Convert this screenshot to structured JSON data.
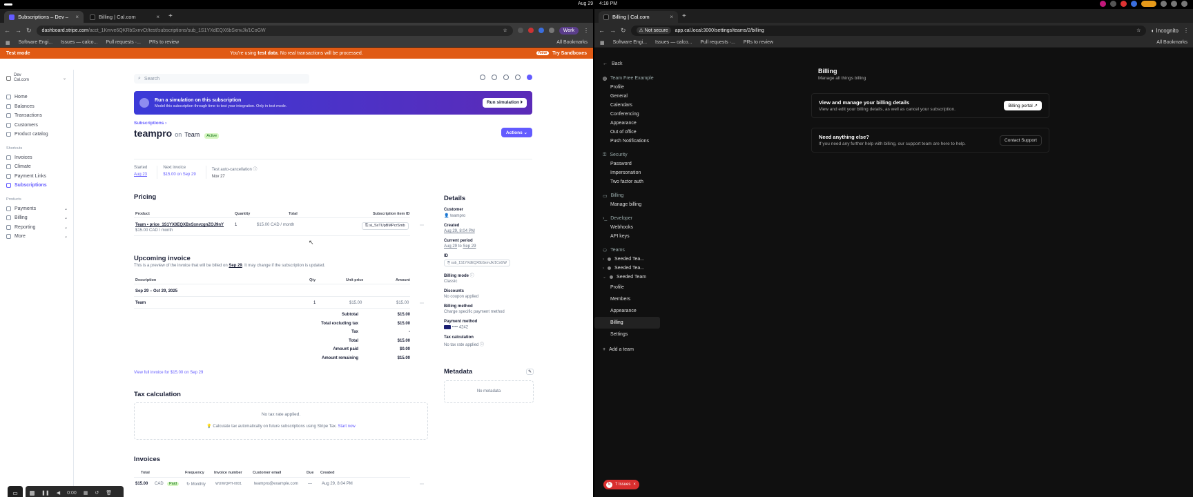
{
  "os": {
    "date": "Aug 29",
    "time": "4:18 PM"
  },
  "left": {
    "tabs": [
      {
        "label": "Subscriptions – Dev –"
      },
      {
        "label": "Billing | Cal.com"
      }
    ],
    "url": {
      "host": "dashboard.stripe.com",
      "path": "/acct_1Kmve6QKRbSxnvCt/test/subscriptions/sub_1S1YXdEQX6bSxnvJk/1CoGW"
    },
    "profile": "Work",
    "bookmarks": [
      "Software Engi...",
      "Issues — calco...",
      "Pull requests ·...",
      "PRs to review"
    ],
    "all_bookmarks": "All Bookmarks",
    "testmode": {
      "label": "Test mode",
      "msg_a": "You're using ",
      "msg_b": "test data",
      "msg_c": ". No real transactions will be processed.",
      "new": "New",
      "sandbox": "Try Sandboxes"
    },
    "account": {
      "line1": "Dev",
      "line2": "Cal.com"
    },
    "nav": [
      "Home",
      "Balances",
      "Transactions",
      "Customers",
      "Product catalog"
    ],
    "shortcuts_label": "Shortcuts",
    "shortcuts": [
      "Invoices",
      "Climate",
      "Payment Links",
      "Subscriptions"
    ],
    "products_label": "Products",
    "products": [
      "Payments",
      "Billing",
      "Reporting",
      "More"
    ],
    "search": "Search",
    "sim": {
      "title": "Run a simulation on this subscription",
      "sub": "Model this subscription through time to test your integration. Only in test mode.",
      "btn": "Run simulation"
    },
    "crumb": "Subscriptions",
    "title": {
      "name": "teampro",
      "on": "on",
      "team": "Team",
      "status": "Active"
    },
    "actions": "Actions",
    "meta": [
      {
        "k": "Started",
        "v": "Aug 23"
      },
      {
        "k": "Next invoice",
        "v": "$15.00 on Sep 29"
      },
      {
        "k": "Test auto-cancellation",
        "v": "Nov 27"
      }
    ],
    "pricing": {
      "title": "Pricing",
      "cols": [
        "Product",
        "Quantity",
        "Total",
        "Subscription item ID"
      ],
      "product": "Team • price_1S1YX0EQXBxSxnvzgnZOJ9nY",
      "subprice": "$15.00 CAD / month",
      "qty": "1",
      "total": "$15.00 CAD / month",
      "itemid": "si_SxTUpBMPcrSmb"
    },
    "upcoming": {
      "title": "Upcoming invoice",
      "desc_a": "This is a preview of the invoice that will be billed on ",
      "desc_b": "Sep 29",
      "desc_c": ". It may change if the subscription is updated.",
      "cols": [
        "Description",
        "Qty",
        "Unit price",
        "Amount"
      ],
      "period": "Sep 29 – Oct 29, 2025",
      "item": "Team",
      "qty": "1",
      "unit": "$15.00",
      "amount": "$15.00",
      "summary": [
        {
          "k": "Subtotal",
          "v": "$15.00"
        },
        {
          "k": "Total excluding tax",
          "v": "$15.00"
        },
        {
          "k": "Tax",
          "v": "-"
        },
        {
          "k": "Total",
          "v": "$15.00"
        },
        {
          "k": "Amount paid",
          "v": "$0.00"
        },
        {
          "k": "Amount remaining",
          "v": "$15.00"
        }
      ],
      "view": "View full invoice for $15.00 on Sep 29"
    },
    "tax": {
      "title": "Tax calculation",
      "none": "No tax rate applied.",
      "hint": "Calculate tax automatically on future subscriptions using Stripe Tax.",
      "start": "Start now"
    },
    "invoices": {
      "title": "Invoices",
      "cols": [
        "Total",
        "Frequency",
        "Invoice number",
        "Customer email",
        "Due",
        "Created"
      ],
      "row": {
        "total": "$15.00",
        "cur": "CAD",
        "status": "Paid",
        "freq": "Monthly",
        "num": "WUIWQPH-0001",
        "email": "teampro@example.com",
        "due": "—",
        "created": "Aug 29, 8:04 PM"
      }
    },
    "details": {
      "title": "Details",
      "customer_k": "Customer",
      "customer_v": "teampro",
      "created_k": "Created",
      "created_v": "Aug 29, 8:04 PM",
      "period_k": "Current period",
      "period_a": "Aug 29",
      "period_to": "to",
      "period_b": "Sep 29",
      "id_k": "ID",
      "id_v": "sub_1S1YXdEQX6bSxnvJk/1CoGW",
      "mode_k": "Billing mode",
      "mode_v": "Classic",
      "disc_k": "Discounts",
      "disc_v": "No coupon applied",
      "bm_k": "Billing method",
      "bm_v": "Charge specific payment method",
      "pm_k": "Payment method",
      "pm_v": "•••• 4242",
      "tax_k": "Tax calculation",
      "tax_v": "No tax rate applied"
    },
    "metadata": {
      "title": "Metadata",
      "empty": "No metadata"
    },
    "rec": {
      "time": "0:00"
    }
  },
  "right": {
    "tab": "Billing | Cal.com",
    "secure": "Not secure",
    "url": "app.cal.local:3000/settings/teams/2/billing",
    "incognito": "Incognito",
    "bookmarks": [
      "Software Engi...",
      "Issues — calco...",
      "Pull requests ·...",
      "PRs to review"
    ],
    "all_bookmarks": "All Bookmarks",
    "back": "Back",
    "team_name": "Team Free Example",
    "team_items": [
      "Profile",
      "General",
      "Calendars",
      "Conferencing",
      "Appearance",
      "Out of office",
      "Push Notifications"
    ],
    "security": "Security",
    "security_items": [
      "Password",
      "Impersonation",
      "Two factor auth"
    ],
    "billing": "Billing",
    "billing_items": [
      "Manage billing"
    ],
    "developer": "Developer",
    "developer_items": [
      "Webhooks",
      "API keys"
    ],
    "teams": "Teams",
    "team_list": [
      "Seeded Tea...",
      "Seeded Tea...",
      "Seeded Team"
    ],
    "seeded_items": [
      "Profile",
      "Members",
      "Appearance",
      "Billing",
      "Settings"
    ],
    "add_team": "Add a team",
    "page_title": "Billing",
    "page_sub": "Manage all things billing",
    "card1": {
      "title": "View and manage your billing details",
      "sub": "View and edit your billing details, as well as cancel your subscription.",
      "btn": "Billing portal"
    },
    "card2": {
      "title": "Need anything else?",
      "sub": "If you need any further help with billing, our support team are here to help.",
      "btn": "Contact Support"
    },
    "issues": {
      "n": "N",
      "label": "7 Issues"
    }
  }
}
